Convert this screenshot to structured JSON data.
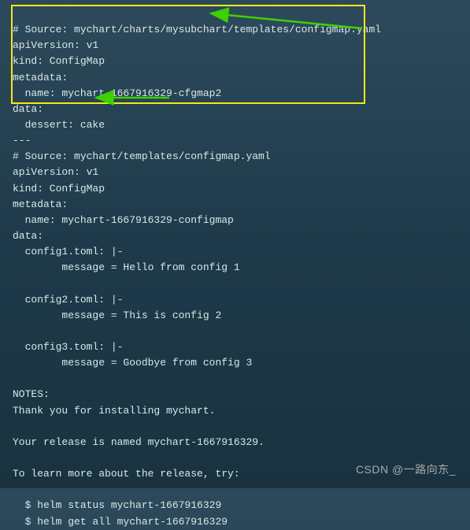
{
  "terminal": {
    "boxed": {
      "line1": "# Source: mychart/charts/mysubchart/templates/configmap.yaml",
      "line2": "apiVersion: v1",
      "line3": "kind: ConfigMap",
      "line4": "metadata:",
      "line5": "  name: mychart-1667916329-cfgmap2",
      "line6": "data:",
      "line7": "  dessert: cake"
    },
    "rest": {
      "line8": "---",
      "line9": "# Source: mychart/templates/configmap.yaml",
      "line10": "apiVersion: v1",
      "line11": "kind: ConfigMap",
      "line12": "metadata:",
      "line13": "  name: mychart-1667916329-configmap",
      "line14": "data:",
      "line15": "  config1.toml: |-",
      "line16": "        message = Hello from config 1",
      "line17": "",
      "line18": "  config2.toml: |-",
      "line19": "        message = This is config 2",
      "line20": "",
      "line21": "  config3.toml: |-",
      "line22": "        message = Goodbye from config 3",
      "line23": "",
      "line24": "NOTES:",
      "line25": "Thank you for installing mychart.",
      "line26": "",
      "line27": "Your release is named mychart-1667916329.",
      "line28": "",
      "line29": "To learn more about the release, try:",
      "line30": "",
      "line31": "  $ helm status mychart-1667916329",
      "line32": "  $ helm get all mychart-1667916329"
    }
  },
  "watermark": "CSDN @一路向东_",
  "annotations": {
    "highlight_color": "#f5e815",
    "arrow_color": "#3bd200"
  }
}
